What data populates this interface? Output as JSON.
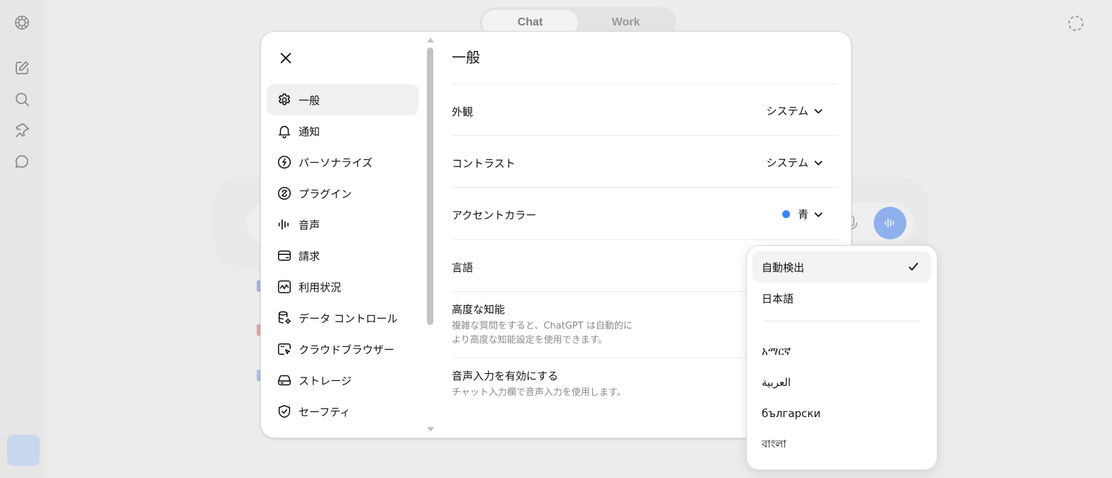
{
  "background": {
    "mode_tabs": [
      {
        "label": "Chat",
        "active": true
      },
      {
        "label": "Work",
        "active": false
      }
    ],
    "rail_icons": [
      "new-chat-icon",
      "search-icon",
      "pin-icon",
      "chat-bubble-icon"
    ],
    "voice_button_color": "#8fb0ec"
  },
  "settings": {
    "nav": [
      {
        "id": "general",
        "label": "一般",
        "icon": "gear-icon",
        "active": true
      },
      {
        "id": "notifications",
        "label": "通知",
        "icon": "bell-icon"
      },
      {
        "id": "personalize",
        "label": "パーソナライズ",
        "icon": "personalize-icon"
      },
      {
        "id": "plugins",
        "label": "プラグイン",
        "icon": "plugin-icon"
      },
      {
        "id": "voice",
        "label": "音声",
        "icon": "waveform-icon"
      },
      {
        "id": "billing",
        "label": "請求",
        "icon": "card-icon"
      },
      {
        "id": "usage",
        "label": "利用状況",
        "icon": "usage-chart-icon"
      },
      {
        "id": "data-controls",
        "label": "データ コントロール",
        "icon": "database-gear-icon"
      },
      {
        "id": "cloud-browser",
        "label": "クラウドブラウザー",
        "icon": "cloud-browser-icon"
      },
      {
        "id": "storage",
        "label": "ストレージ",
        "icon": "storage-icon"
      },
      {
        "id": "safety",
        "label": "セーフティ",
        "icon": "shield-check-icon"
      }
    ],
    "general": {
      "title": "一般",
      "appearance": {
        "label": "外観",
        "value": "システム"
      },
      "contrast": {
        "label": "コントラスト",
        "value": "システム"
      },
      "accent_color": {
        "label": "アクセントカラー",
        "value": "青",
        "color": "#3b82f6"
      },
      "language": {
        "label": "言語"
      },
      "advanced_intelligence": {
        "label": "高度な知能",
        "description": "複雑な質問をすると、ChatGPT は自動的により高度な知能設定を使用できます。"
      },
      "voice_input": {
        "label": "音声入力を有効にする",
        "description": "チャット入力欄で音声入力を使用します。"
      }
    }
  },
  "language_dropdown": {
    "primary": [
      {
        "label": "自動検出",
        "selected": true
      },
      {
        "label": "日本語",
        "selected": false
      }
    ],
    "languages": [
      {
        "label": "አማርኛ"
      },
      {
        "label": "العربية"
      },
      {
        "label": "български"
      },
      {
        "label": "বাংলা"
      }
    ]
  }
}
